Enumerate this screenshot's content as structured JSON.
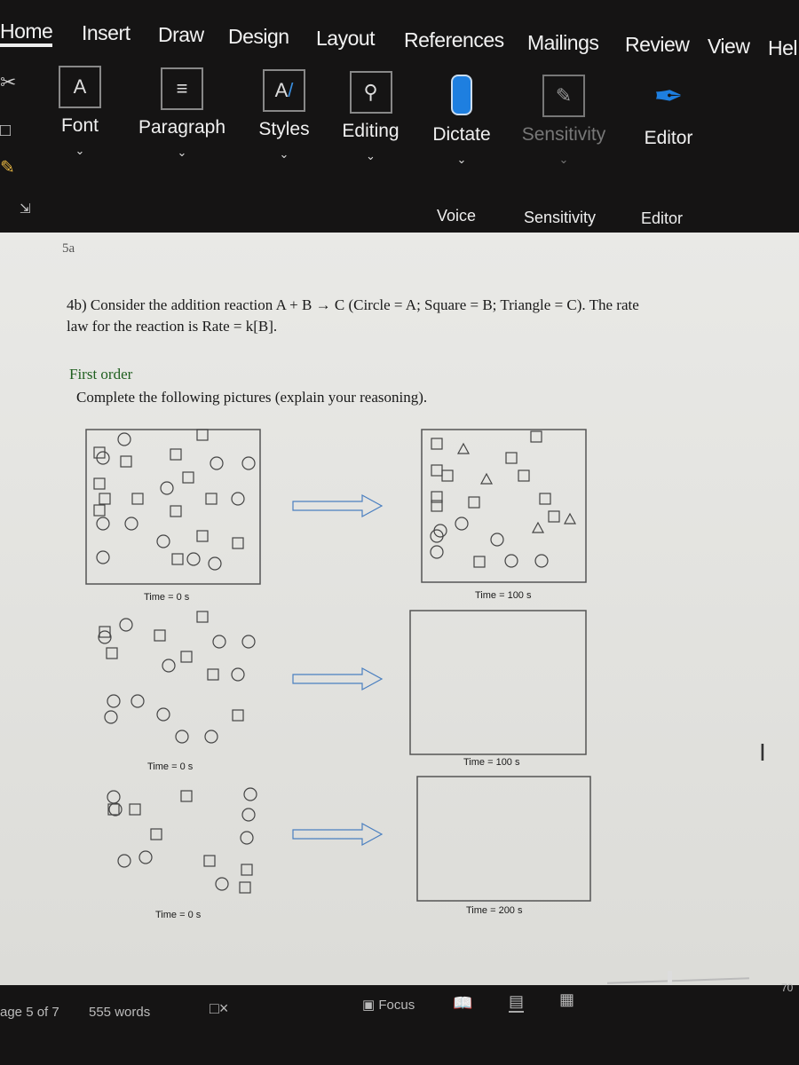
{
  "ribbon_tabs": [
    "Home",
    "Insert",
    "Draw",
    "Design",
    "Layout",
    "References",
    "Mailings",
    "Review",
    "View",
    "Hel"
  ],
  "groups": [
    {
      "label": "Font",
      "icon": "font-icon"
    },
    {
      "label": "Paragraph",
      "icon": "paragraph-icon"
    },
    {
      "label": "Styles",
      "icon": "styles-icon"
    },
    {
      "label": "Editing",
      "icon": "search-icon"
    },
    {
      "label": "Dictate",
      "icon": "microphone-icon"
    },
    {
      "label": "Sensitivity",
      "icon": "sensitivity-icon"
    },
    {
      "label": "Editor",
      "icon": "editor-pen-icon"
    }
  ],
  "group_labels": [
    "Voice",
    "Sensitivity",
    "Editor"
  ],
  "accent": "#1e7fe0",
  "document": {
    "page_marker": "5a",
    "question_line1": "4b) Consider the addition reaction A + B → C (Circle = A; Square = B; Triangle = C).  The rate",
    "question_line2": "law for the reaction is Rate = k[B].",
    "answer": "First order",
    "instruction": "Complete the following pictures (explain your reasoning).",
    "time_labels": [
      "Time = 0 s",
      "Time = 100 s",
      "Time = 0 s",
      "Time = 100 s",
      "Time = 0 s",
      "Time = 200 s"
    ]
  },
  "status": {
    "page": "age 5 of 7",
    "words": "555 words",
    "focus": "Focus",
    "zoom": "70"
  }
}
